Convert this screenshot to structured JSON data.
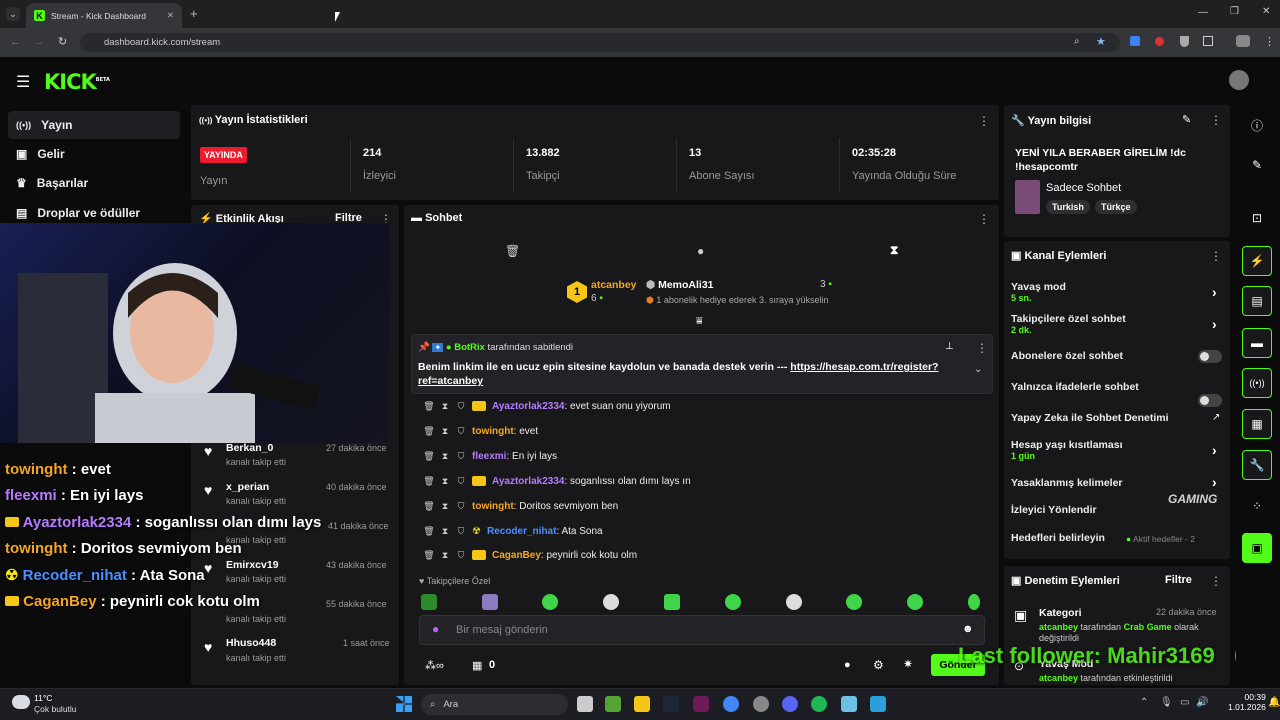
{
  "browser": {
    "tab_title": "Stream - Kick Dashboard",
    "url": "dashboard.kick.com/stream"
  },
  "header": {
    "logo": "KICK",
    "logo_sup": "BETA"
  },
  "sidebar": {
    "items": [
      {
        "label": "Yayın",
        "icon": "broadcast-icon"
      },
      {
        "label": "Gelir",
        "icon": "wallet-icon"
      },
      {
        "label": "Başarılar",
        "icon": "trophy-icon"
      },
      {
        "label": "Droplar ve ödüller",
        "icon": "gift-icon"
      }
    ]
  },
  "stats": {
    "title": "Yayın İstatistikleri",
    "live_badge": "YAYINDA",
    "live_label": "Yayın",
    "viewers": "214",
    "viewers_label": "İzleyici",
    "followers": "13.882",
    "followers_label": "Takipçi",
    "subs": "13",
    "subs_label": "Abone Sayısı",
    "duration": "02:35:28",
    "duration_label": "Yayında Olduğu Süre"
  },
  "activity": {
    "title": "Etkinlik Akışı",
    "filter": "Filtre",
    "events": [
      {
        "name": "Berkan_0",
        "sub": "kanalı takip etti",
        "time": "27 dakika önce"
      },
      {
        "name": "x_perian",
        "sub": "kanalı takip etti",
        "time": "40 dakika önce"
      },
      {
        "name": "",
        "sub": "kanalı takip etti",
        "time": "41 dakika önce"
      },
      {
        "name": "Emirxcv19",
        "sub": "kanalı takip etti",
        "time": "43 dakika önce"
      },
      {
        "name": "",
        "sub": "kanalı takip etti",
        "time": "55 dakika önce"
      },
      {
        "name": "Hhuso448",
        "sub": "kanalı takip etti",
        "time": "1 saat önce"
      }
    ]
  },
  "chat": {
    "title": "Sohbet",
    "leader1": {
      "rank": "1",
      "name": "atcanbey",
      "count": "6"
    },
    "leader2": {
      "name": "MemoAli31",
      "count": "3",
      "note": "1 abonelik hediye ederek 3. sıraya yükselin"
    },
    "pinned": {
      "by_user": "BotRix",
      "by_text": "tarafından sabitlendi",
      "text": "Benim linkim ile en ucuz epin sitesine kaydolun ve banada destek verin --- ",
      "link": "https://hesap.com.tr/register?ref=atcanbey"
    },
    "messages": [
      {
        "user": "Ayaztorlak2334",
        "color": "#b57cff",
        "text": "evet suan onu yiyorum"
      },
      {
        "user": "towinght",
        "color": "#f5a623",
        "text": "evet"
      },
      {
        "user": "fleexmi",
        "color": "#b57cff",
        "text": "En iyi lays"
      },
      {
        "user": "Ayaztorlak2334",
        "color": "#b57cff",
        "text": "soganlıssı olan dımı lays ın"
      },
      {
        "user": "towinght",
        "color": "#f5a623",
        "text": "Doritos sevmiyom ben"
      },
      {
        "user": "Recoder_nihat",
        "color": "#4a90ff",
        "text": "Ata Sona"
      },
      {
        "user": "CaganBey",
        "color": "#f5a623",
        "text": "peynirli cok kotu olm"
      }
    ],
    "followers_only": "Takipçilere Özel",
    "placeholder": "Bir mesaj gönderin",
    "points": "0",
    "send": "Gönder"
  },
  "info": {
    "title": "Yayın bilgisi",
    "stream_title": "YENİ YILA BERABER GİRELİM !dc !hesapcomtr",
    "category": "Sadece Sohbet",
    "tags": [
      "Turkish",
      "Türkçe"
    ]
  },
  "channel_actions": {
    "title": "Kanal Eylemleri",
    "items": [
      {
        "label": "Yavaş mod",
        "sub": "5 sn."
      },
      {
        "label": "Takipçilere özel sohbet",
        "sub": "2 dk."
      },
      {
        "label": "Abonelere özel sohbet",
        "sub": ""
      },
      {
        "label": "Yalnızca ifadelerle sohbet",
        "sub": ""
      },
      {
        "label": "Yapay Zeka ile Sohbet Denetimi",
        "sub": ""
      },
      {
        "label": "Hesap yaşı kısıtlaması",
        "sub": "1 gün"
      },
      {
        "label": "Yasaklanmış kelimeler",
        "sub": ""
      },
      {
        "label": "İzleyici Yönlendir",
        "sub": ""
      },
      {
        "label": "Hedefleri belirleyin",
        "sub": "Aktif hedefler - 2"
      }
    ]
  },
  "mod_actions": {
    "title": "Denetim Eylemleri",
    "filter": "Filtre",
    "items": [
      {
        "title": "Kategori",
        "time": "22 dakika önce",
        "user": "atcanbey",
        "text1": " tarafından ",
        "target": "Crab Game",
        "text2": " olarak değiştirildi"
      },
      {
        "title": "Yavaş Mod",
        "user": "atcanbey",
        "text1": " tarafından etkinleştirildi"
      }
    ]
  },
  "overlay": {
    "lines": [
      {
        "user": "towinght",
        "color": "#f5a623",
        "text": " : evet"
      },
      {
        "user": "fleexmi",
        "color": "#b57cff",
        "text": " : En iyi lays"
      },
      {
        "user": "Ayaztorlak2334",
        "color": "#b57cff",
        "text": " : soganlıssı olan dımı lays"
      },
      {
        "user": "towinght",
        "color": "#f5a623",
        "text": " : Doritos sevmiyom ben"
      },
      {
        "user": "Recoder_nihat",
        "color": "#4a90ff",
        "text": " : Ata Sona"
      },
      {
        "user": "CaganBey",
        "color": "#f5a623",
        "text": " : peynirli cok kotu olm"
      }
    ],
    "last_follower": "Last follower: Mahir3169",
    "gaming": "GAMING"
  },
  "taskbar": {
    "weather_temp": "11°C",
    "weather_desc": "Çok bulutlu",
    "search": "Ara",
    "time": "00:39",
    "date": "1.01.2026"
  }
}
